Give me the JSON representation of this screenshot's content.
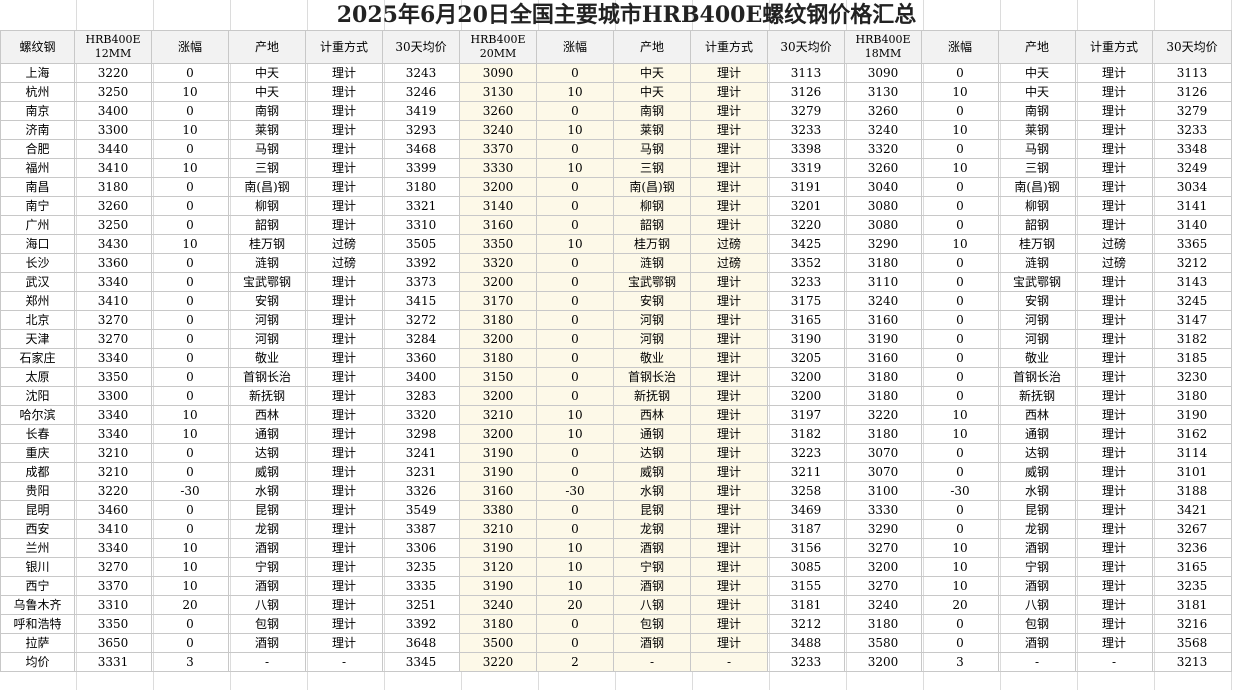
{
  "title": "2025年6月20日全国主要城市HRB400E螺纹钢价格汇总",
  "headers": [
    "螺纹钢",
    "HRB400E\n12MM",
    "涨幅",
    "产地",
    "计重方式",
    "30天均价",
    "HRB400E\n20MM",
    "涨幅",
    "产地",
    "计重方式",
    "30天均价",
    "HRB400E\n18MM",
    "涨幅",
    "产地",
    "计重方式",
    "30天均价"
  ],
  "rows": [
    [
      "上海",
      "3220",
      "0",
      "中天",
      "理计",
      "3243",
      "3090",
      "0",
      "中天",
      "理计",
      "3113",
      "3090",
      "0",
      "中天",
      "理计",
      "3113"
    ],
    [
      "杭州",
      "3250",
      "10",
      "中天",
      "理计",
      "3246",
      "3130",
      "10",
      "中天",
      "理计",
      "3126",
      "3130",
      "10",
      "中天",
      "理计",
      "3126"
    ],
    [
      "南京",
      "3400",
      "0",
      "南钢",
      "理计",
      "3419",
      "3260",
      "0",
      "南钢",
      "理计",
      "3279",
      "3260",
      "0",
      "南钢",
      "理计",
      "3279"
    ],
    [
      "济南",
      "3300",
      "10",
      "莱钢",
      "理计",
      "3293",
      "3240",
      "10",
      "莱钢",
      "理计",
      "3233",
      "3240",
      "10",
      "莱钢",
      "理计",
      "3233"
    ],
    [
      "合肥",
      "3440",
      "0",
      "马钢",
      "理计",
      "3468",
      "3370",
      "0",
      "马钢",
      "理计",
      "3398",
      "3320",
      "0",
      "马钢",
      "理计",
      "3348"
    ],
    [
      "福州",
      "3410",
      "10",
      "三钢",
      "理计",
      "3399",
      "3330",
      "10",
      "三钢",
      "理计",
      "3319",
      "3260",
      "10",
      "三钢",
      "理计",
      "3249"
    ],
    [
      "南昌",
      "3180",
      "0",
      "南(昌)钢",
      "理计",
      "3180",
      "3200",
      "0",
      "南(昌)钢",
      "理计",
      "3191",
      "3040",
      "0",
      "南(昌)钢",
      "理计",
      "3034"
    ],
    [
      "南宁",
      "3260",
      "0",
      "柳钢",
      "理计",
      "3321",
      "3140",
      "0",
      "柳钢",
      "理计",
      "3201",
      "3080",
      "0",
      "柳钢",
      "理计",
      "3141"
    ],
    [
      "广州",
      "3250",
      "0",
      "韶钢",
      "理计",
      "3310",
      "3160",
      "0",
      "韶钢",
      "理计",
      "3220",
      "3080",
      "0",
      "韶钢",
      "理计",
      "3140"
    ],
    [
      "海口",
      "3430",
      "10",
      "桂万钢",
      "过磅",
      "3505",
      "3350",
      "10",
      "桂万钢",
      "过磅",
      "3425",
      "3290",
      "10",
      "桂万钢",
      "过磅",
      "3365"
    ],
    [
      "长沙",
      "3360",
      "0",
      "涟钢",
      "过磅",
      "3392",
      "3320",
      "0",
      "涟钢",
      "过磅",
      "3352",
      "3180",
      "0",
      "涟钢",
      "过磅",
      "3212"
    ],
    [
      "武汉",
      "3340",
      "0",
      "宝武鄂钢",
      "理计",
      "3373",
      "3200",
      "0",
      "宝武鄂钢",
      "理计",
      "3233",
      "3110",
      "0",
      "宝武鄂钢",
      "理计",
      "3143"
    ],
    [
      "郑州",
      "3410",
      "0",
      "安钢",
      "理计",
      "3415",
      "3170",
      "0",
      "安钢",
      "理计",
      "3175",
      "3240",
      "0",
      "安钢",
      "理计",
      "3245"
    ],
    [
      "北京",
      "3270",
      "0",
      "河钢",
      "理计",
      "3272",
      "3180",
      "0",
      "河钢",
      "理计",
      "3165",
      "3160",
      "0",
      "河钢",
      "理计",
      "3147"
    ],
    [
      "天津",
      "3270",
      "0",
      "河钢",
      "理计",
      "3284",
      "3200",
      "0",
      "河钢",
      "理计",
      "3190",
      "3190",
      "0",
      "河钢",
      "理计",
      "3182"
    ],
    [
      "石家庄",
      "3340",
      "0",
      "敬业",
      "理计",
      "3360",
      "3180",
      "0",
      "敬业",
      "理计",
      "3205",
      "3160",
      "0",
      "敬业",
      "理计",
      "3185"
    ],
    [
      "太原",
      "3350",
      "0",
      "首钢长治",
      "理计",
      "3400",
      "3150",
      "0",
      "首钢长治",
      "理计",
      "3200",
      "3180",
      "0",
      "首钢长治",
      "理计",
      "3230"
    ],
    [
      "沈阳",
      "3300",
      "0",
      "新抚钢",
      "理计",
      "3283",
      "3200",
      "0",
      "新抚钢",
      "理计",
      "3200",
      "3180",
      "0",
      "新抚钢",
      "理计",
      "3180"
    ],
    [
      "哈尔滨",
      "3340",
      "10",
      "西林",
      "理计",
      "3320",
      "3210",
      "10",
      "西林",
      "理计",
      "3197",
      "3220",
      "10",
      "西林",
      "理计",
      "3190"
    ],
    [
      "长春",
      "3340",
      "10",
      "通钢",
      "理计",
      "3298",
      "3200",
      "10",
      "通钢",
      "理计",
      "3182",
      "3180",
      "10",
      "通钢",
      "理计",
      "3162"
    ],
    [
      "重庆",
      "3210",
      "0",
      "达钢",
      "理计",
      "3241",
      "3190",
      "0",
      "达钢",
      "理计",
      "3223",
      "3070",
      "0",
      "达钢",
      "理计",
      "3114"
    ],
    [
      "成都",
      "3210",
      "0",
      "威钢",
      "理计",
      "3231",
      "3190",
      "0",
      "威钢",
      "理计",
      "3211",
      "3070",
      "0",
      "威钢",
      "理计",
      "3101"
    ],
    [
      "贵阳",
      "3220",
      "-30",
      "水钢",
      "理计",
      "3326",
      "3160",
      "-30",
      "水钢",
      "理计",
      "3258",
      "3100",
      "-30",
      "水钢",
      "理计",
      "3188"
    ],
    [
      "昆明",
      "3460",
      "0",
      "昆钢",
      "理计",
      "3549",
      "3380",
      "0",
      "昆钢",
      "理计",
      "3469",
      "3330",
      "0",
      "昆钢",
      "理计",
      "3421"
    ],
    [
      "西安",
      "3410",
      "0",
      "龙钢",
      "理计",
      "3387",
      "3210",
      "0",
      "龙钢",
      "理计",
      "3187",
      "3290",
      "0",
      "龙钢",
      "理计",
      "3267"
    ],
    [
      "兰州",
      "3340",
      "10",
      "酒钢",
      "理计",
      "3306",
      "3190",
      "10",
      "酒钢",
      "理计",
      "3156",
      "3270",
      "10",
      "酒钢",
      "理计",
      "3236"
    ],
    [
      "银川",
      "3270",
      "10",
      "宁钢",
      "理计",
      "3235",
      "3120",
      "10",
      "宁钢",
      "理计",
      "3085",
      "3200",
      "10",
      "宁钢",
      "理计",
      "3165"
    ],
    [
      "西宁",
      "3370",
      "10",
      "酒钢",
      "理计",
      "3335",
      "3190",
      "10",
      "酒钢",
      "理计",
      "3155",
      "3270",
      "10",
      "酒钢",
      "理计",
      "3235"
    ],
    [
      "乌鲁木齐",
      "3310",
      "20",
      "八钢",
      "理计",
      "3251",
      "3240",
      "20",
      "八钢",
      "理计",
      "3181",
      "3240",
      "20",
      "八钢",
      "理计",
      "3181"
    ],
    [
      "呼和浩特",
      "3350",
      "0",
      "包钢",
      "理计",
      "3392",
      "3180",
      "0",
      "包钢",
      "理计",
      "3212",
      "3180",
      "0",
      "包钢",
      "理计",
      "3216"
    ],
    [
      "拉萨",
      "3650",
      "0",
      "酒钢",
      "理计",
      "3648",
      "3500",
      "0",
      "酒钢",
      "理计",
      "3488",
      "3580",
      "0",
      "酒钢",
      "理计",
      "3568"
    ]
  ],
  "average_row": [
    "均价",
    "3331",
    "3",
    "-",
    "-",
    "3345",
    "3220",
    "2",
    "-",
    "-",
    "3233",
    "3200",
    "3",
    "-",
    "-",
    "3213"
  ],
  "colors": {
    "price_blue": "#1f3fc8",
    "highlight_yellow": "#fdf9e8",
    "header_gray": "#f2f2f2"
  }
}
